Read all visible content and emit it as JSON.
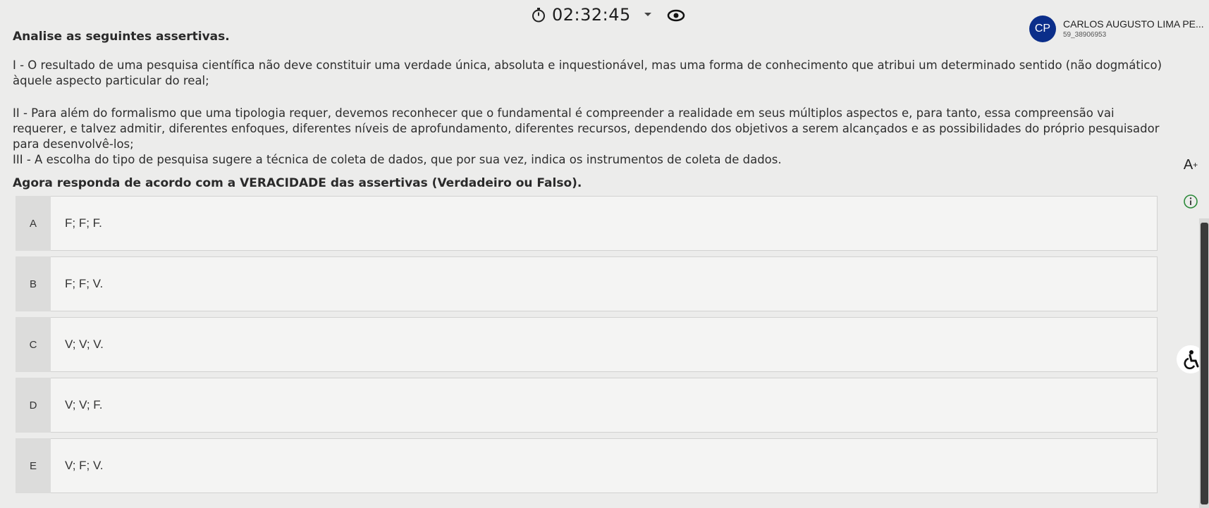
{
  "header": {
    "timer": "02:32:45",
    "user": {
      "initials": "CP",
      "name": "CARLOS AUGUSTO LIMA PE...",
      "id": "59_38906953"
    }
  },
  "question": {
    "prompt": "Analise as seguintes assertivas.",
    "assertions": [
      "I - O resultado de uma pesquisa científica não deve constituir uma verdade única, absoluta e inquestionável, mas uma forma de conhecimento que atribui um determinado sentido (não dogmático) àquele aspecto particular do real;",
      "II - Para além do formalismo que uma tipologia requer, devemos reconhecer que o fundamental é compreender a realidade em seus múltiplos aspectos e, para tanto, essa compreensão vai requerer, e talvez admitir, diferentes enfoques, diferentes níveis de aprofundamento, diferentes recursos, dependendo dos objetivos a serem alcançados e as possibilidades do próprio pesquisador para desenvolvê-los;",
      "III - A escolha do tipo de pesquisa sugere a técnica de coleta de dados, que por sua vez, indica os instrumentos de coleta de dados."
    ],
    "instruction": "Agora responda de acordo com a VERACIDADE das assertivas (Verdadeiro ou Falso).",
    "options": [
      {
        "letter": "A",
        "text": "F; F; F."
      },
      {
        "letter": "B",
        "text": "F; F; V."
      },
      {
        "letter": "C",
        "text": "V; V; V."
      },
      {
        "letter": "D",
        "text": "V; V; F."
      },
      {
        "letter": "E",
        "text": "V; F; V."
      }
    ]
  },
  "tools": {
    "font_increase": "A",
    "font_increase_sup": "+"
  },
  "icons": {
    "timer": "stopwatch-icon",
    "caret": "chevron-down-icon",
    "visibility": "eye-icon",
    "info": "info-icon",
    "accessibility": "accessibility-icon"
  },
  "colors": {
    "avatar": "#0b2e8a",
    "background": "#ececeb",
    "option_letter_bg": "#dcdcdb",
    "option_body_bg": "#f4f4f3"
  }
}
